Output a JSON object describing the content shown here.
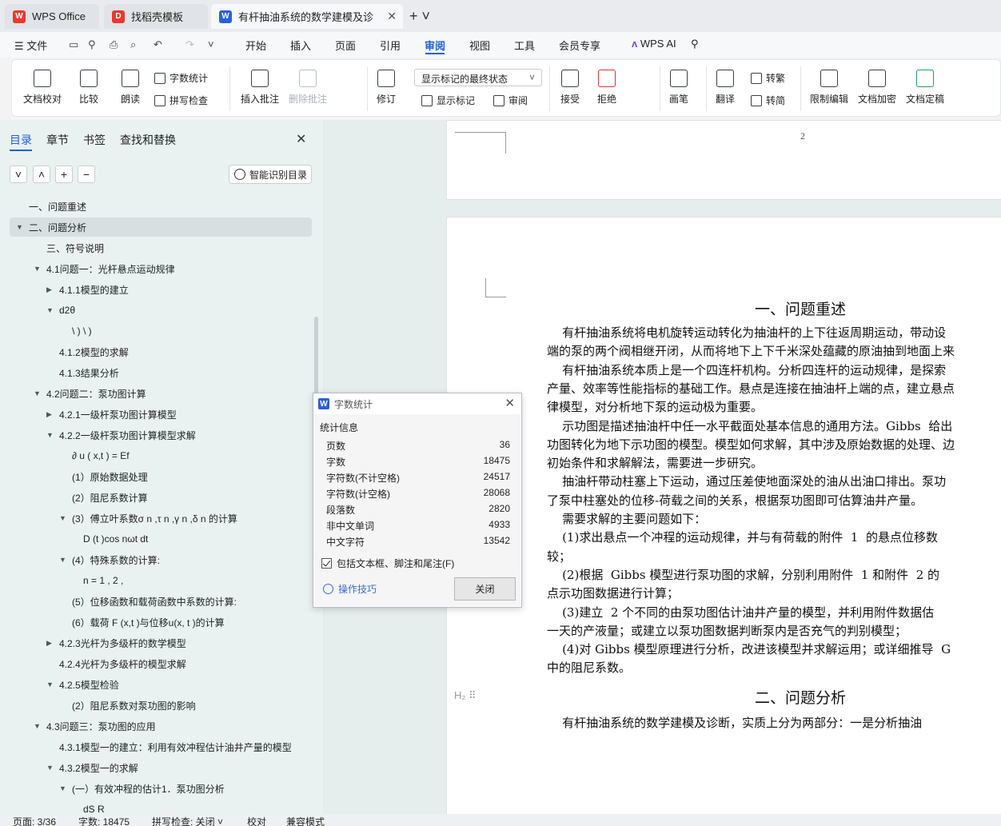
{
  "tabs": [
    {
      "label": "WPS Office",
      "icon": "wps-logo-icon"
    },
    {
      "label": "找稻壳模板",
      "icon": "docer-icon"
    },
    {
      "label": "有杆抽油系统的数学建模及诊",
      "icon": "writer-icon"
    }
  ],
  "menu": {
    "file": "文件",
    "items": [
      "开始",
      "插入",
      "页面",
      "引用",
      "审阅",
      "视图",
      "工具",
      "会员专享"
    ],
    "active": "审阅",
    "wps_ai": "WPS AI"
  },
  "ribbon": {
    "doc_proof": "文档校对",
    "compare": "比较",
    "read_aloud": "朗读",
    "word_count": "字数统计",
    "spell_check": "拼写检查",
    "insert_comment": "插入批注",
    "delete_comment": "删除批注",
    "revise": "修订",
    "markup_state": "显示标记的最终状态",
    "show_markup": "显示标记",
    "review": "审阅",
    "accept": "接受",
    "reject": "拒绝",
    "pen": "画笔",
    "translate": "翻译",
    "to_traditional": "转繁",
    "to_simplified": "转简",
    "restrict_edit": "限制编辑",
    "encrypt": "文档加密",
    "finalize": "文档定稿"
  },
  "left_panel": {
    "tabs": [
      "目录",
      "章节",
      "书签",
      "查找和替换"
    ],
    "smart_toc": "智能识别目录",
    "toc": [
      {
        "text": "一、问题重述",
        "level": 0,
        "arrow": ""
      },
      {
        "text": "二、问题分析",
        "level": 0,
        "arrow": "down",
        "selected": true
      },
      {
        "text": "三、符号说明",
        "level": 1,
        "arrow": ""
      },
      {
        "text": "4.1问题一：光杆悬点运动规律",
        "level": 1,
        "arrow": "down"
      },
      {
        "text": "4.1.1模型的建立",
        "level": 2,
        "arrow": "right"
      },
      {
        "text": "d2θ",
        "level": 2,
        "arrow": "down"
      },
      {
        "text": "\\ ) \\ )",
        "level": 3,
        "arrow": ""
      },
      {
        "text": "4.1.2模型的求解",
        "level": 2,
        "arrow": ""
      },
      {
        "text": "4.1.3结果分析",
        "level": 2,
        "arrow": ""
      },
      {
        "text": "4.2问题二：泵功图计算",
        "level": 1,
        "arrow": "down"
      },
      {
        "text": "4.2.1一级杆泵功图计算模型",
        "level": 2,
        "arrow": "right"
      },
      {
        "text": "4.2.2一级杆泵功图计算模型求解",
        "level": 2,
        "arrow": "down"
      },
      {
        "text": "∂ u ( x,t ) = Ef",
        "level": 3,
        "arrow": ""
      },
      {
        "text": "(1）原始数据处理",
        "level": 3,
        "arrow": ""
      },
      {
        "text": "(2）阻尼系数计算",
        "level": 3,
        "arrow": ""
      },
      {
        "text": "(3）傅立叶系数σ n ,τ n ,γ n ,δ n 的计算",
        "level": 3,
        "arrow": "down"
      },
      {
        "text": "D (t )cos nωt dt",
        "level": 4,
        "arrow": ""
      },
      {
        "text": "(4）特殊系数的计算:",
        "level": 3,
        "arrow": "down"
      },
      {
        "text": "n = 1 , 2 ,",
        "level": 4,
        "arrow": ""
      },
      {
        "text": "(5）位移函数和载荷函数中系数的计算:",
        "level": 3,
        "arrow": ""
      },
      {
        "text": "(6）载荷 F (x,t )与位移u(x, t )的计算",
        "level": 3,
        "arrow": ""
      },
      {
        "text": "4.2.3光杆为多级杆的数学模型",
        "level": 2,
        "arrow": "right"
      },
      {
        "text": "4.2.4光杆为多级杆的模型求解",
        "level": 2,
        "arrow": ""
      },
      {
        "text": "4.2.5模型检验",
        "level": 2,
        "arrow": "down"
      },
      {
        "text": "(2）阻尼系数对泵功图的影响",
        "level": 3,
        "arrow": ""
      },
      {
        "text": "4.3问题三：泵功图的应用",
        "level": 1,
        "arrow": "down"
      },
      {
        "text": "4.3.1模型一的建立：利用有效冲程估计油井产量的模型",
        "level": 2,
        "arrow": ""
      },
      {
        "text": "4.3.2模型一的求解",
        "level": 2,
        "arrow": "down"
      },
      {
        "text": "(一）有效冲程的估计1．泵功图分析",
        "level": 3,
        "arrow": "down"
      },
      {
        "text": "dS R",
        "level": 4,
        "arrow": ""
      }
    ]
  },
  "document": {
    "page_number": "2",
    "heading1": "一、问题重述",
    "paragraphs": [
      "    有杆抽油系统将电机旋转运动转化为抽油杆的上下往返周期运动，带动设",
      "端的泵的两个阀相继开闭，从而将地下上下千米深处蕴藏的原油抽到地面上来",
      "    有杆抽油系统本质上是一个四连杆机构。分析四连杆的运动规律，是探索",
      "产量、效率等性能指标的基础工作。悬点是连接在抽油杆上端的点，建立悬点",
      "律模型，对分析地下泵的运动极为重要。",
      "    示功图是描述抽油杆中任一水平截面处基本信息的通用方法。Gibbs  给出",
      "功图转化为地下示功图的模型。模型如何求解，其中涉及原始数据的处理、边",
      "初始条件和求解解法，需要进一步研究。",
      "    抽油杆带动柱塞上下运动，通过压差使地面深处的油从出油口排出。泵功",
      "了泵中柱塞处的位移-荷载之间的关系，根据泵功图即可估算油井产量。",
      "    需要求解的主要问题如下：",
      "    (1)求出悬点一个冲程的运动规律，并与有荷载的附件  1  的悬点位移数",
      "较；",
      "    (2)根据  Gibbs 模型进行泵功图的求解，分别利用附件  1 和附件  2 的",
      "点示功图数据进行计算；",
      "    (3)建立  2 个不同的由泵功图估计油井产量的模型，并利用附件数据估",
      "一天的产液量；或建立以泵功图数据判断泵内是否充气的判别模型；",
      "    (4)对 Gibbs 模型原理进行分析，改进该模型并求解运用；或详细推导  G",
      "中的阻尼系数。"
    ],
    "heading2": "二、问题分析",
    "paragraph2": "    有杆抽油系统的数学建模及诊断，实质上分为两部分：一是分析抽油"
  },
  "dialog": {
    "title": "字数统计",
    "section": "统计信息",
    "rows": [
      {
        "label": "页数",
        "value": "36"
      },
      {
        "label": "字数",
        "value": "18475"
      },
      {
        "label": "字符数(不计空格)",
        "value": "24517"
      },
      {
        "label": "字符数(计空格)",
        "value": "28068"
      },
      {
        "label": "段落数",
        "value": "2820"
      },
      {
        "label": "非中文单词",
        "value": "4933"
      },
      {
        "label": "中文字符",
        "value": "13542"
      }
    ],
    "include_label": "包括文本框、脚注和尾注(F)",
    "tips": "操作技巧",
    "close": "关闭"
  },
  "status": {
    "page": "页面: 3/36",
    "words": "字数: 18475",
    "spell": "拼写检查: 关闭",
    "proof": "校对",
    "compat": "兼容模式"
  }
}
